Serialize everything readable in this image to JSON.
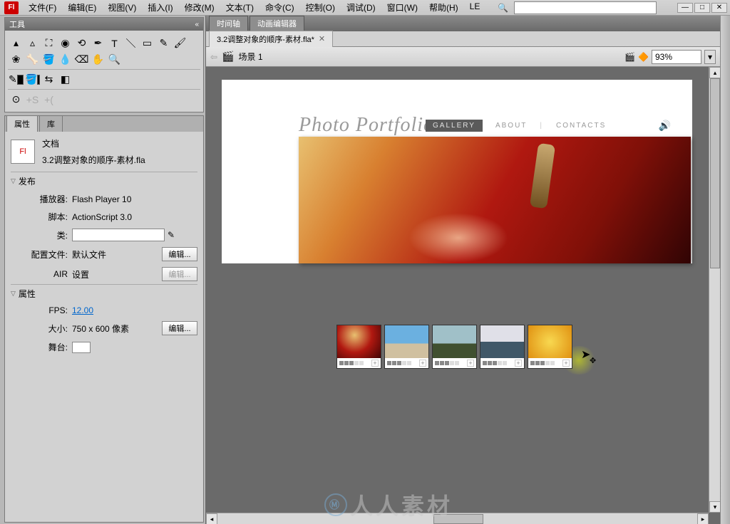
{
  "app": {
    "id": "Fl"
  },
  "menu": [
    "文件(F)",
    "编辑(E)",
    "视图(V)",
    "插入(I)",
    "修改(M)",
    "文本(T)",
    "命令(C)",
    "控制(O)",
    "调试(D)",
    "窗口(W)",
    "帮助(H)",
    "LE"
  ],
  "tools_title": "工具",
  "timeline_tabs": [
    "时间轴",
    "动画编辑器"
  ],
  "document_tab": "3.2调整对象的顺序-素材.fla*",
  "scene_label": "场景 1",
  "zoom": "93%",
  "props": {
    "tab_props": "属性",
    "tab_lib": "库",
    "doc_type": "文档",
    "doc_name": "3.2调整对象的顺序-素材.fla",
    "section_publish": "发布",
    "player_label": "播放器:",
    "player_value": "Flash Player 10",
    "script_label": "脚本:",
    "script_value": "ActionScript 3.0",
    "class_label": "类:",
    "class_value": "",
    "profile_label": "配置文件:",
    "profile_value": "默认文件",
    "air_label": "AIR",
    "air_value": "设置",
    "section_attrs": "属性",
    "fps_label": "FPS:",
    "fps_value": "12.00",
    "size_label": "大小:",
    "size_value": "750 x 600 像素",
    "stage_label": "舞台:",
    "edit_btn": "编辑..."
  },
  "site": {
    "title": "Photo Portfolio",
    "nav_gallery": "GALLERY",
    "nav_about": "ABOUT",
    "nav_contacts": "CONTACTS"
  },
  "watermark": "人人素材"
}
